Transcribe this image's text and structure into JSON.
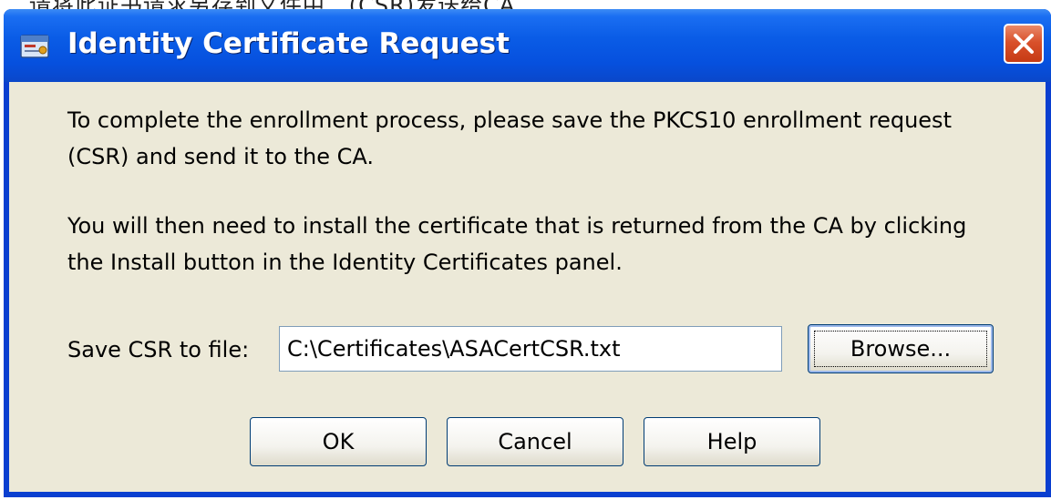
{
  "top_fragment": "...请将此证书请求另存到文件中...(CSR)发送给CA...",
  "window": {
    "title": "Identity Certificate Request",
    "icon": "certificate-app-icon",
    "close_icon": "close-x-icon"
  },
  "message": {
    "paragraph1": "To complete the enrollment process, please save the PKCS10 enrollment request (CSR) and send it to the CA.",
    "paragraph2": "You will then need to install the certificate that is returned from the CA by clicking the Install button in the Identity Certificates panel."
  },
  "save_field": {
    "label": "Save CSR to file:",
    "value": "C:\\Certificates\\ASACertCSR.txt"
  },
  "buttons": {
    "browse": "Browse...",
    "ok": "OK",
    "cancel": "Cancel",
    "help": "Help"
  },
  "colors": {
    "titlebar": "#0a5ce6",
    "client": "#ece9d8",
    "close_button": "#d9512b"
  }
}
